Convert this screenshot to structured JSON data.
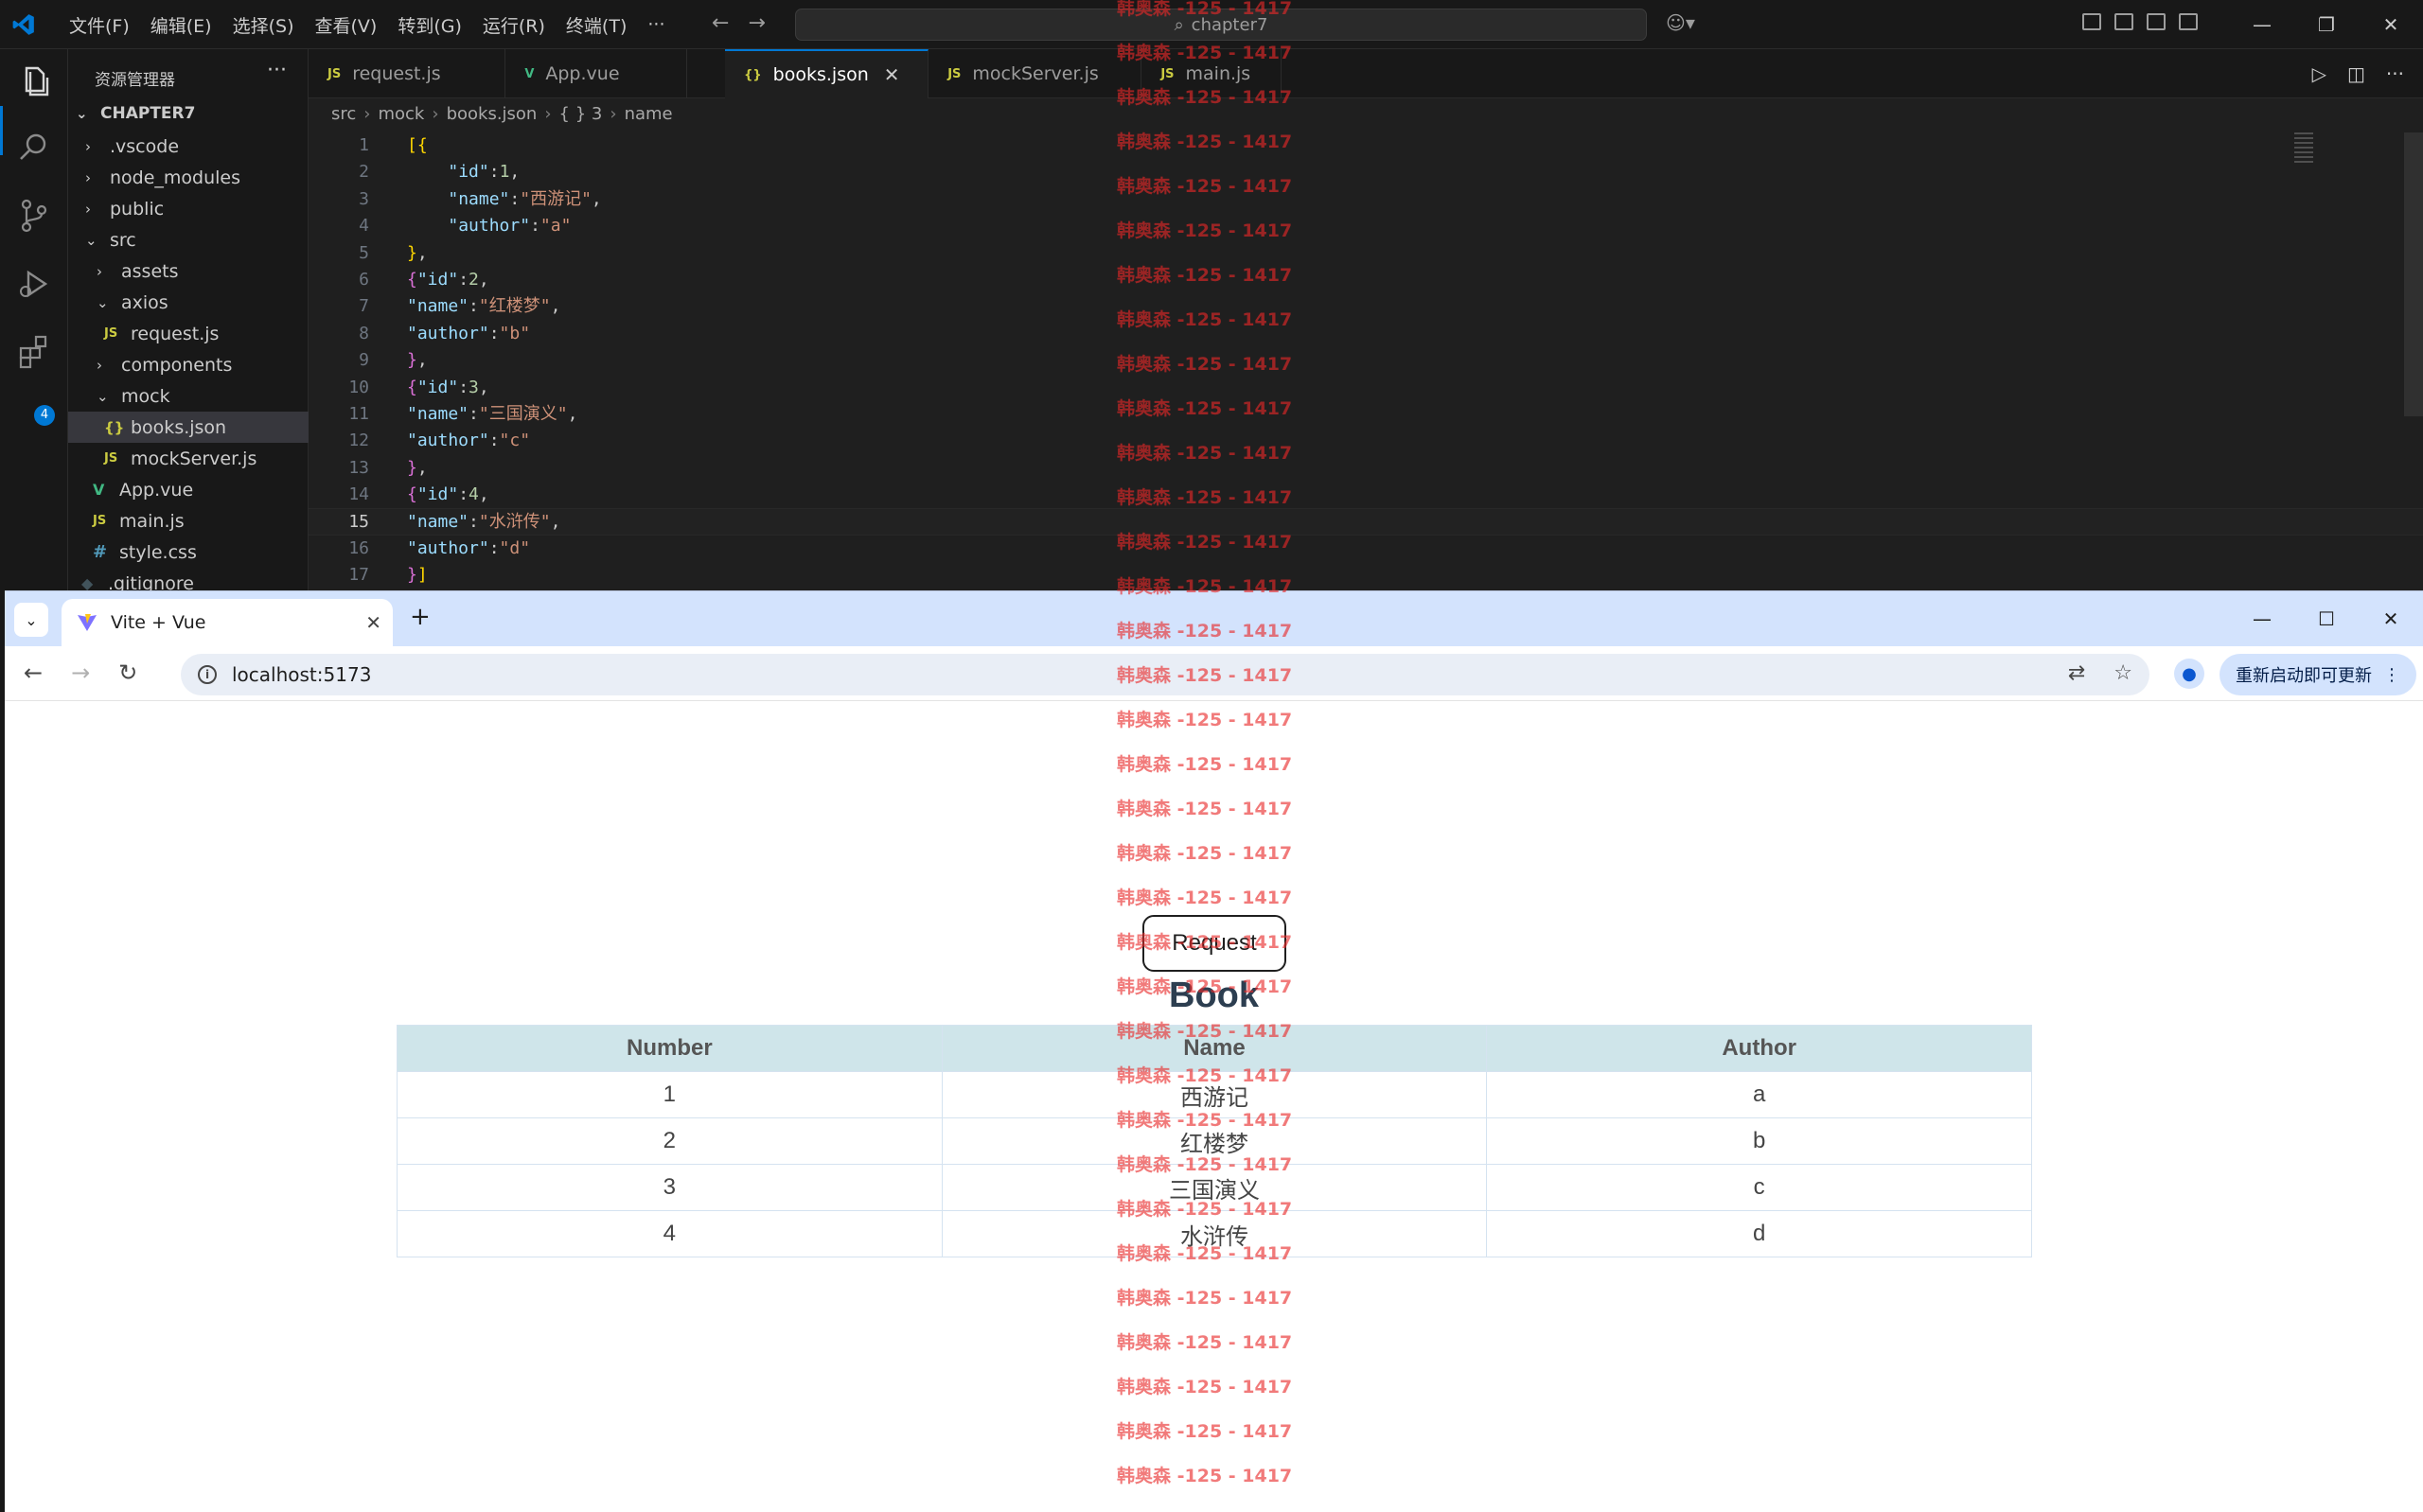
{
  "vscode": {
    "menu": [
      "文件(F)",
      "编辑(E)",
      "选择(S)",
      "查看(V)",
      "转到(G)",
      "运行(R)",
      "终端(T)",
      "···"
    ],
    "search_text": "chapter7",
    "explorer_title": "资源管理器",
    "root_folder": "CHAPTER7",
    "tree": [
      {
        "label": ".vscode",
        "type": "folder",
        "open": false,
        "depth": 1
      },
      {
        "label": "node_modules",
        "type": "folder",
        "open": false,
        "depth": 1
      },
      {
        "label": "public",
        "type": "folder",
        "open": false,
        "depth": 1
      },
      {
        "label": "src",
        "type": "folder",
        "open": true,
        "depth": 1
      },
      {
        "label": "assets",
        "type": "folder",
        "open": false,
        "depth": 2
      },
      {
        "label": "axios",
        "type": "folder",
        "open": true,
        "depth": 2
      },
      {
        "label": "request.js",
        "type": "js",
        "depth": 3
      },
      {
        "label": "components",
        "type": "folder",
        "open": false,
        "depth": 2
      },
      {
        "label": "mock",
        "type": "folder",
        "open": true,
        "depth": 2
      },
      {
        "label": "books.json",
        "type": "json",
        "depth": 3,
        "selected": true
      },
      {
        "label": "mockServer.js",
        "type": "js",
        "depth": 3
      },
      {
        "label": "App.vue",
        "type": "vue",
        "depth": 2
      },
      {
        "label": "main.js",
        "type": "js",
        "depth": 2
      },
      {
        "label": "style.css",
        "type": "css",
        "depth": 2
      },
      {
        "label": ".gitignore",
        "type": "git",
        "depth": 1
      }
    ],
    "tabs": [
      {
        "label": "request.js",
        "icon": "JS",
        "active": false
      },
      {
        "label": "App.vue",
        "icon": "V",
        "active": false
      },
      {
        "label": "books.json",
        "icon": "{}",
        "active": true
      },
      {
        "label": "mockServer.js",
        "icon": "JS",
        "active": false
      },
      {
        "label": "main.js",
        "icon": "JS",
        "active": false
      }
    ],
    "breadcrumb": [
      "src",
      "mock",
      "books.json",
      "{ } 3",
      "name"
    ],
    "activity_badge": "4",
    "code_lines": [
      [
        [
          "b1",
          "[{"
        ]
      ],
      [
        [
          "p",
          "    "
        ],
        [
          "k",
          "\"id\""
        ],
        [
          "p",
          ":"
        ],
        [
          "n",
          "1"
        ],
        [
          "p",
          ","
        ]
      ],
      [
        [
          "p",
          "    "
        ],
        [
          "k",
          "\"name\""
        ],
        [
          "p",
          ":"
        ],
        [
          "s",
          "\"西游记\""
        ],
        [
          "p",
          ","
        ]
      ],
      [
        [
          "p",
          "    "
        ],
        [
          "k",
          "\"author\""
        ],
        [
          "p",
          ":"
        ],
        [
          "s",
          "\"a\""
        ]
      ],
      [
        [
          "b1",
          "}"
        ],
        [
          "p",
          ","
        ]
      ],
      [
        [
          "b2",
          "{"
        ],
        [
          "k",
          "\"id\""
        ],
        [
          "p",
          ":"
        ],
        [
          "n",
          "2"
        ],
        [
          "p",
          ","
        ]
      ],
      [
        [
          "k",
          "\"name\""
        ],
        [
          "p",
          ":"
        ],
        [
          "s",
          "\"红楼梦\""
        ],
        [
          "p",
          ","
        ]
      ],
      [
        [
          "k",
          "\"author\""
        ],
        [
          "p",
          ":"
        ],
        [
          "s",
          "\"b\""
        ]
      ],
      [
        [
          "b2",
          "}"
        ],
        [
          "p",
          ","
        ]
      ],
      [
        [
          "b2",
          "{"
        ],
        [
          "k",
          "\"id\""
        ],
        [
          "p",
          ":"
        ],
        [
          "n",
          "3"
        ],
        [
          "p",
          ","
        ]
      ],
      [
        [
          "k",
          "\"name\""
        ],
        [
          "p",
          ":"
        ],
        [
          "s",
          "\"三国演义\""
        ],
        [
          "p",
          ","
        ]
      ],
      [
        [
          "k",
          "\"author\""
        ],
        [
          "p",
          ":"
        ],
        [
          "s",
          "\"c\""
        ]
      ],
      [
        [
          "b2",
          "}"
        ],
        [
          "p",
          ","
        ]
      ],
      [
        [
          "b2",
          "{"
        ],
        [
          "k",
          "\"id\""
        ],
        [
          "p",
          ":"
        ],
        [
          "n",
          "4"
        ],
        [
          "p",
          ","
        ]
      ],
      [
        [
          "k",
          "\"name\""
        ],
        [
          "p",
          ":"
        ],
        [
          "s",
          "\"水浒传\""
        ],
        [
          "p",
          ","
        ]
      ],
      [
        [
          "k",
          "\"author\""
        ],
        [
          "p",
          ":"
        ],
        [
          "s",
          "\"d\""
        ]
      ],
      [
        [
          "b2",
          "}"
        ],
        [
          "b1",
          "]"
        ]
      ]
    ],
    "current_line": 15
  },
  "browser": {
    "tab_title": "Vite + Vue",
    "url": "localhost:5173",
    "update_label": "重新启动即可更新",
    "page": {
      "button_label": "Request",
      "heading": "Book",
      "columns": [
        "Number",
        "Name",
        "Author"
      ],
      "rows": [
        [
          "1",
          "西游记",
          "a"
        ],
        [
          "2",
          "红楼梦",
          "b"
        ],
        [
          "3",
          "三国演义",
          "c"
        ],
        [
          "4",
          "水浒传",
          "d"
        ]
      ]
    }
  },
  "watermark_text": "韩奥森 -125 - 1417",
  "watermark_count": 34,
  "colors": {
    "vscode_accent": "#0078d4",
    "browser_tabstrip": "#d3e3fd",
    "table_header": "#cfe5ea",
    "watermark": "#e82828"
  }
}
